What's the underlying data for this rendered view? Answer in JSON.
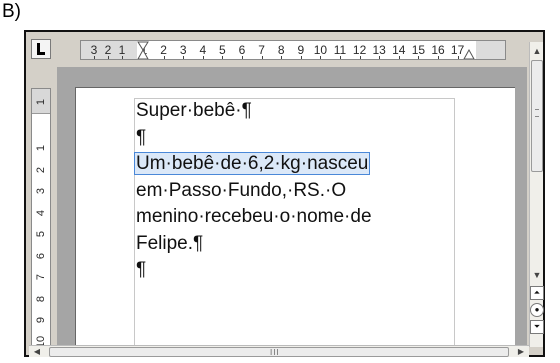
{
  "caption": "B)",
  "ruler": {
    "corner_label": "tab-stop-left",
    "horizontal_ticks": [
      "3",
      "2",
      "1",
      "1",
      "2",
      "3",
      "4",
      "5",
      "6",
      "7",
      "8",
      "9",
      "10",
      "11",
      "12",
      "13",
      "14",
      "15",
      "16",
      "17"
    ],
    "vertical_ticks": [
      "1",
      "1",
      "2",
      "3",
      "4",
      "5",
      "6",
      "7",
      "8",
      "9",
      "10"
    ]
  },
  "document": {
    "lines": [
      {
        "text": "Super·bebê·¶",
        "selected": false
      },
      {
        "text": "¶",
        "selected": false
      },
      {
        "text": "Um·bebê·de·6,2·kg·nasceu",
        "selected": true
      },
      {
        "text": "em·Passo·Fundo,·RS.·O",
        "selected": false
      },
      {
        "text": "menino·recebeu·o·nome·de",
        "selected": false
      },
      {
        "text": "Felipe.¶",
        "selected": false
      },
      {
        "text": "¶",
        "selected": false
      }
    ]
  },
  "scrollbar": {
    "up_icon": "arrow-up-icon",
    "down_icon": "arrow-down-icon",
    "prev_page_icon": "double-up-icon",
    "navigator_icon": "circle-icon",
    "next_page_icon": "double-down-icon",
    "grip": "III"
  },
  "colors": {
    "selection_fill": "#dbe8f8",
    "selection_border": "#4a88d8",
    "workspace": "#a5a5a5"
  }
}
